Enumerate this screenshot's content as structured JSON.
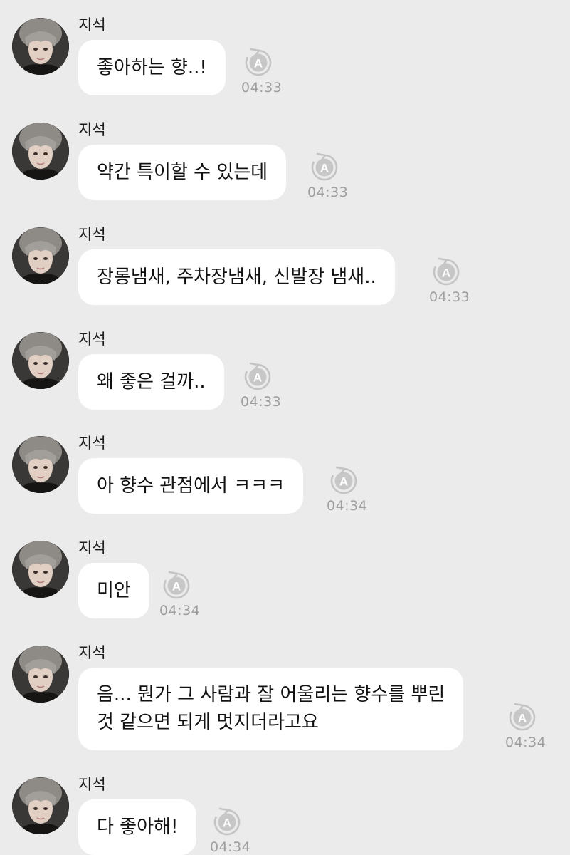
{
  "messages": [
    {
      "sender": "지석",
      "lines": [
        "좋아하는 향..!"
      ],
      "time": "04:33",
      "status_icon": "translate-refresh-icon"
    },
    {
      "sender": "지석",
      "lines": [
        "약간 특이할 수 있는데"
      ],
      "time": "04:33",
      "status_icon": "translate-refresh-icon"
    },
    {
      "sender": "지석",
      "lines": [
        "장롱냄새, 주차장냄새, 신발장 냄새.."
      ],
      "time": "04:33",
      "status_icon": "translate-refresh-icon"
    },
    {
      "sender": "지석",
      "lines": [
        "왜 좋은 걸까.."
      ],
      "time": "04:33",
      "status_icon": "translate-refresh-icon"
    },
    {
      "sender": "지석",
      "lines": [
        "아 향수 관점에서 ㅋㅋㅋ"
      ],
      "time": "04:34",
      "status_icon": "translate-refresh-icon"
    },
    {
      "sender": "지석",
      "lines": [
        "미안"
      ],
      "time": "04:34",
      "status_icon": "translate-refresh-icon"
    },
    {
      "sender": "지석",
      "lines": [
        "음... 뭔가 그 사람과 잘 어울리는 향수를 뿌린",
        "것 같으면 되게 멋지더라고요"
      ],
      "time": "04:34",
      "status_icon": "translate-refresh-icon"
    },
    {
      "sender": "지석",
      "lines": [
        "다 좋아해!"
      ],
      "time": "04:34",
      "status_icon": "translate-refresh-icon"
    }
  ]
}
